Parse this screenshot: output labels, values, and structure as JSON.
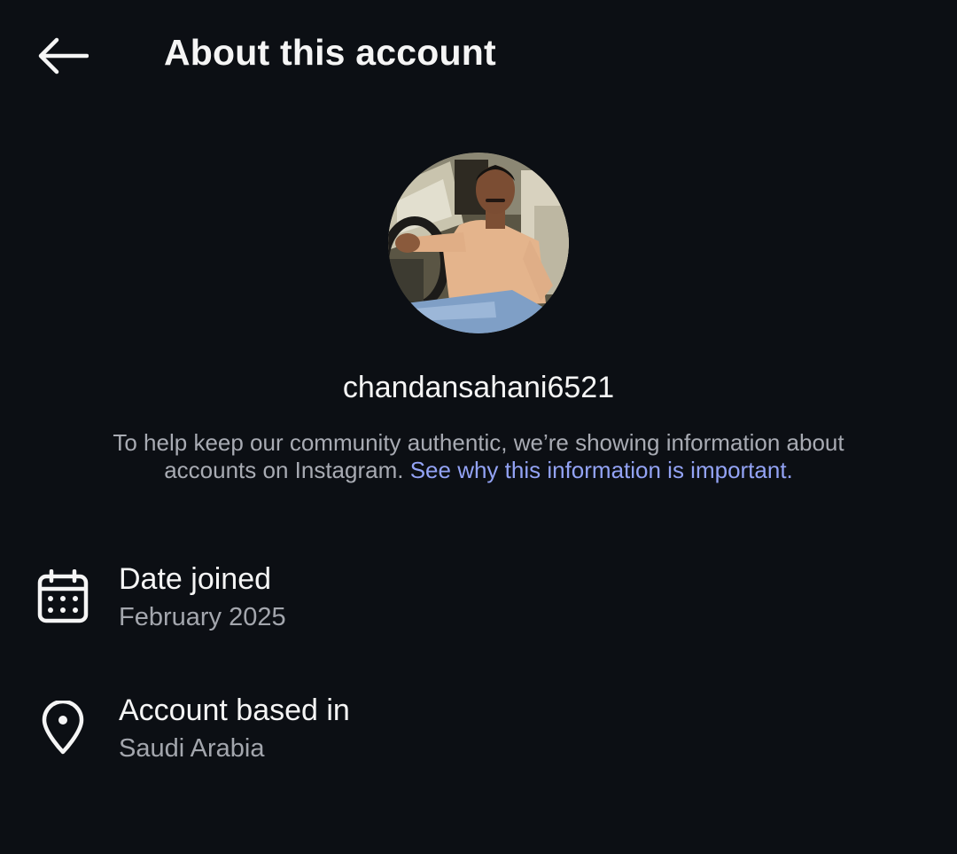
{
  "header": {
    "title": "About this account",
    "back_icon": "arrow-left-icon"
  },
  "profile": {
    "username": "chandansahani6521",
    "avatar_description_icon": "profile-photo"
  },
  "notice": {
    "text": "To help keep our community authentic, we’re showing information about accounts on Instagram.",
    "link_text": "See why this information is important.",
    "link_color": "#93a3f5"
  },
  "details": {
    "date_joined": {
      "label": "Date joined",
      "value": "February 2025",
      "icon": "calendar-icon"
    },
    "account_based_in": {
      "label": "Account based in",
      "value": "Saudi Arabia",
      "icon": "location-pin-icon"
    }
  },
  "colors": {
    "background": "#0c0f14",
    "primary_text": "#f5f5f5",
    "secondary_text": "#a3a6ad"
  }
}
